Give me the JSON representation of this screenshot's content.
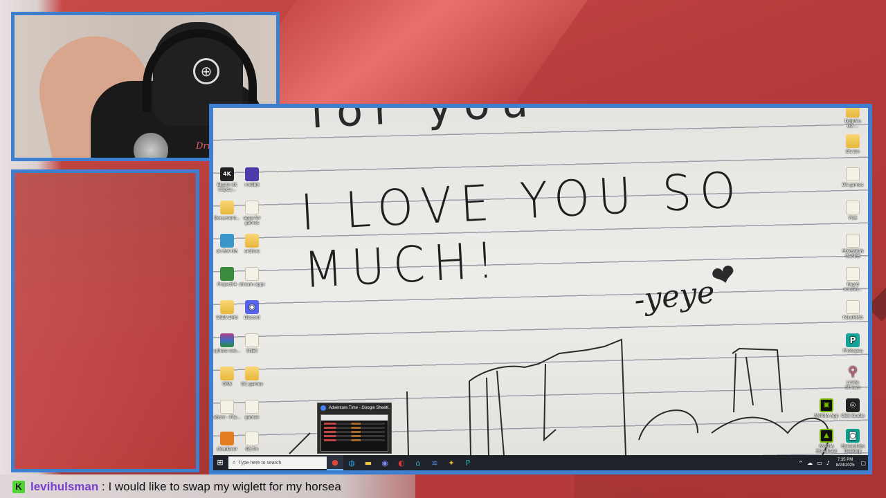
{
  "stream": {
    "chat": {
      "badge": "K",
      "username": "levihulsman",
      "separator": " : ",
      "message": "I would like to swap my wiglett for my horsea"
    },
    "webcam": {
      "cap_logo": "⊕",
      "shirt_text": "Drift"
    }
  },
  "desktop": {
    "handwriting": {
      "main": "I LOVE YOU SO MUCH!",
      "top_partial": "for you",
      "signature": "-yeye",
      "heart": "❤"
    },
    "icons_left": [
      {
        "label": "Elgato 4K Captur...",
        "glyph": "4K",
        "type": "g-4k"
      },
      {
        "label": "rmOBA",
        "glyph": "",
        "type": "g-purple"
      },
      {
        "label": "Document...",
        "glyph": "",
        "type": "g-folder"
      },
      {
        "label": "apps for games",
        "glyph": "",
        "type": "g-file"
      },
      {
        "label": "ok Bot GG",
        "glyph": "",
        "type": "g-bot"
      },
      {
        "label": "archive",
        "glyph": "",
        "type": "g-folder"
      },
      {
        "label": "Project64",
        "glyph": "",
        "type": "g-project"
      },
      {
        "label": "stream apps",
        "glyph": "",
        "type": "g-file"
      },
      {
        "label": "SNES EMU",
        "glyph": "",
        "type": "g-folder"
      },
      {
        "label": "Discord",
        "glyph": "◉",
        "type": "g-discord"
      },
      {
        "label": "sphere exe...",
        "glyph": "",
        "type": "g-rar"
      },
      {
        "label": "SNES",
        "glyph": "",
        "type": "g-file"
      },
      {
        "label": "ORN",
        "glyph": "",
        "type": "g-folder"
      },
      {
        "label": "GC games",
        "glyph": "",
        "type": "g-folder"
      },
      {
        "label": "eborn - File...",
        "glyph": "",
        "type": "g-file"
      },
      {
        "label": "games",
        "glyph": "",
        "type": "g-file"
      },
      {
        "label": "cloudaver",
        "glyph": "",
        "type": "g-orange"
      },
      {
        "label": "DS fm",
        "glyph": "",
        "type": "g-file"
      }
    ],
    "icons_right": [
      {
        "label": "Dolphin GC-...",
        "glyph": "",
        "type": "g-folder"
      },
      {
        "label": "DS Em",
        "glyph": "",
        "type": "g-folder"
      },
      {
        "label": "DS games",
        "glyph": "",
        "type": "g-file"
      },
      {
        "label": "PC8",
        "glyph": "",
        "type": "g-file"
      },
      {
        "label": "POKEMON GAMES",
        "glyph": "",
        "type": "g-file"
      },
      {
        "label": "Rapid emulat...",
        "glyph": "",
        "type": "g-file"
      },
      {
        "label": "PokeMMO",
        "glyph": "",
        "type": "g-file"
      },
      {
        "label": "Photopea",
        "glyph": "P",
        "type": "g-photopea"
      },
      {
        "label": "Linkle Stream",
        "glyph": "⚲",
        "type": "g-pin"
      },
      {
        "label": "NVIDIA App",
        "glyph": "▣",
        "type": "g-nvidia"
      },
      {
        "label": "OBS Studio",
        "glyph": "◎",
        "type": "g-obs"
      },
      {
        "label": "NVIDIA Broadcast",
        "glyph": "▲",
        "type": "g-nvidia"
      },
      {
        "label": "Streamlabs Desktop",
        "glyph": "◙",
        "type": "g-stream"
      }
    ],
    "taskbar": {
      "start_glyph": "⊞",
      "search_placeholder": "Type here to search",
      "search_glyph": "⌕",
      "apps": [
        {
          "name": "chrome",
          "glyph": "●",
          "color": "#e0463a"
        },
        {
          "name": "edge",
          "glyph": "◍",
          "color": "#2d9fe0"
        },
        {
          "name": "explorer",
          "glyph": "▬",
          "color": "#f3c744"
        },
        {
          "name": "discord",
          "glyph": "◉",
          "color": "#7d8cf5"
        },
        {
          "name": "app-red",
          "glyph": "◐",
          "color": "#d83b3b"
        },
        {
          "name": "app-teal",
          "glyph": "⌂",
          "color": "#3fb0c9"
        },
        {
          "name": "app-blue",
          "glyph": "≋",
          "color": "#4a8fe0"
        },
        {
          "name": "app-multi",
          "glyph": "✦",
          "color": "#e6b93a"
        },
        {
          "name": "photopea",
          "glyph": "P",
          "color": "#19b29f"
        }
      ],
      "tray": {
        "chevron": "^",
        "cloud": "☁",
        "network": "▭",
        "volume": "♪",
        "time": "7:35 PM",
        "date": "8/24/2025",
        "notif": "▢"
      }
    },
    "thumbnail": {
      "title": "Adventure Time - Google Sheet...",
      "close": "✕"
    }
  }
}
